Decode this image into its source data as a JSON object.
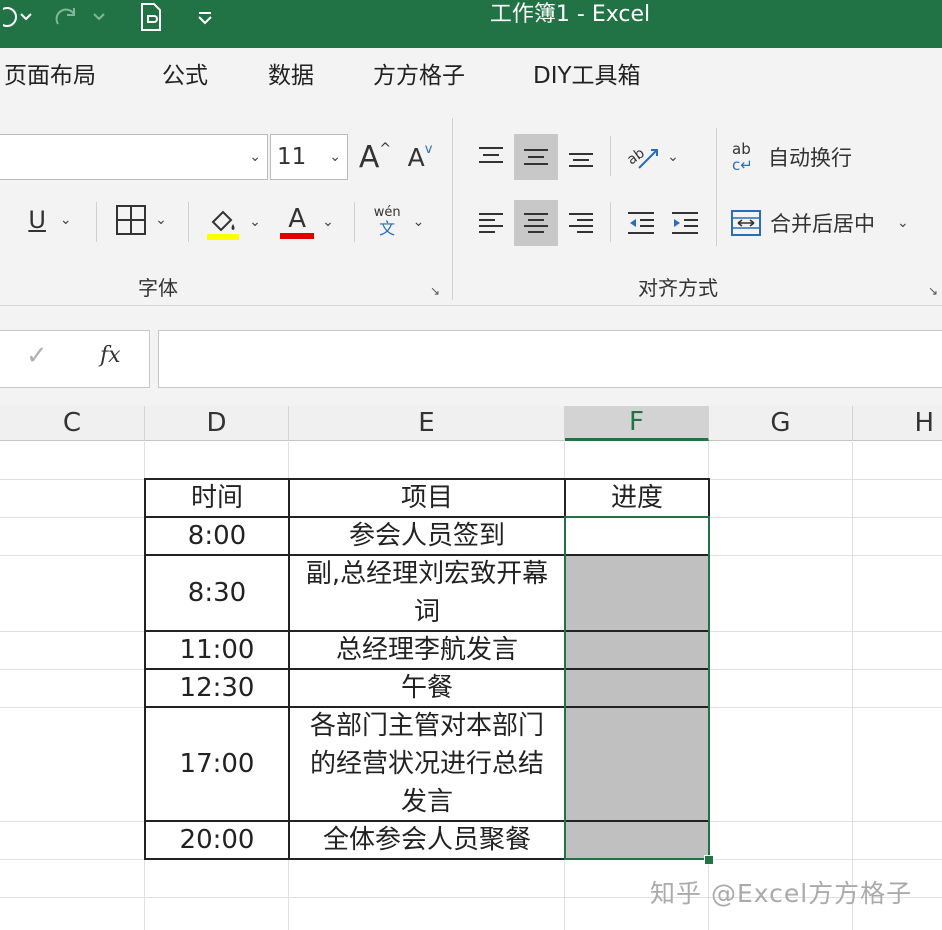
{
  "window": {
    "title": "工作簿1  -  Excel"
  },
  "quick_access": {
    "undo_icon": "undo-icon",
    "redo_icon": "redo-icon",
    "doc_icon": "document-icon",
    "customize_icon": "customize-icon"
  },
  "menu": {
    "tabs": [
      "页面布局",
      "公式",
      "数据",
      "方方格子",
      "DIY工具箱"
    ]
  },
  "ribbon": {
    "font_size": "11",
    "grow_font": "A",
    "shrink_font": "A",
    "underline": "U",
    "font_color_letter": "A",
    "phonetic_top": "wén",
    "phonetic_bottom": "文",
    "font_group": "字体",
    "align_group": "对齐方式",
    "wrap_text": "自动换行",
    "merge_center": "合并后居中",
    "wrap_icon_text": "ab"
  },
  "formula_bar": {
    "confirm": "✓",
    "fx": "fx",
    "content": ""
  },
  "columns": [
    "C",
    "D",
    "E",
    "F",
    "G",
    "H"
  ],
  "active_column": "F",
  "table": {
    "header": {
      "time": "时间",
      "item": "项目",
      "progress": "进度"
    },
    "rows": [
      {
        "time": "8:00",
        "item": "参会人员签到",
        "progress": ""
      },
      {
        "time": "8:30",
        "item": "副,总经理刘宏致开幕词",
        "progress": ""
      },
      {
        "time": "11:00",
        "item": "总经理李航发言",
        "progress": ""
      },
      {
        "time": "12:30",
        "item": "午餐",
        "progress": ""
      },
      {
        "time": "17:00",
        "item": "各部门主管对本部门的经营状况进行总结发言",
        "progress": ""
      },
      {
        "time": "20:00",
        "item": "全体参会人员聚餐",
        "progress": ""
      }
    ]
  },
  "colors": {
    "excel_green": "#217346",
    "highlight_yellow": "#ffff00",
    "font_red": "#e00000",
    "cell_gray": "#c0c0c0"
  },
  "watermark": "知乎 @Excel方方格子"
}
